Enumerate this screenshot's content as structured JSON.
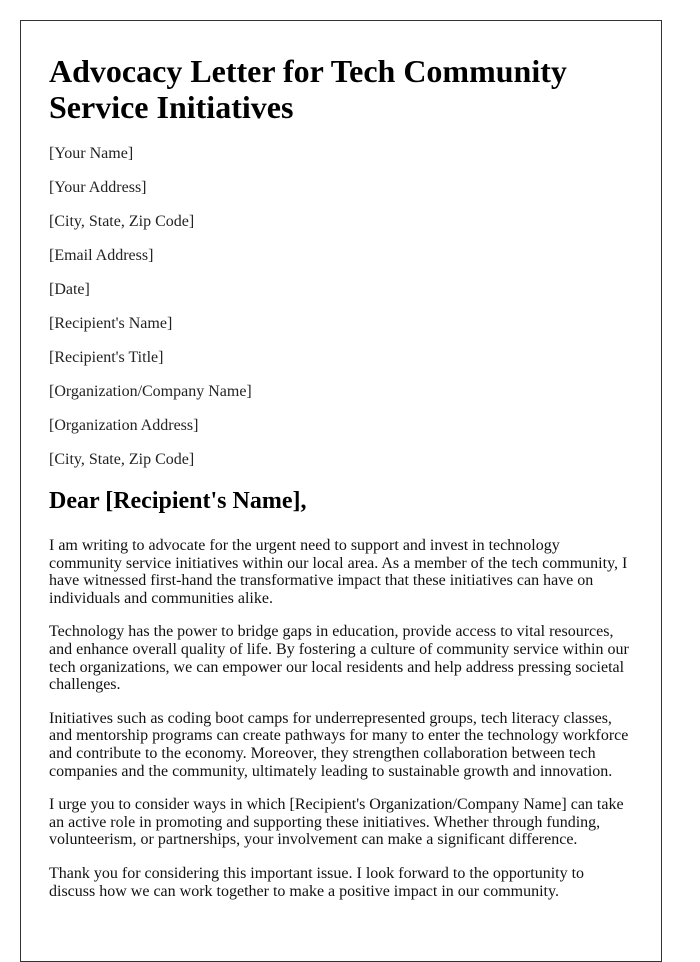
{
  "document": {
    "title": "Advocacy Letter for Tech Community Service Initiatives",
    "sender": {
      "name": "[Your Name]",
      "address": "[Your Address]",
      "city_state_zip": "[City, State, Zip Code]",
      "email": "[Email Address]",
      "date": "[Date]"
    },
    "recipient": {
      "name": "[Recipient's Name]",
      "title": "[Recipient's Title]",
      "organization": "[Organization/Company Name]",
      "organization_address": "[Organization Address]",
      "city_state_zip": "[City, State, Zip Code]"
    },
    "greeting": "Dear [Recipient's Name],",
    "paragraphs": [
      "I am writing to advocate for the urgent need to support and invest in technology community service initiatives within our local area. As a member of the tech community, I have witnessed first-hand the transformative impact that these initiatives can have on individuals and communities alike.",
      "Technology has the power to bridge gaps in education, provide access to vital resources, and enhance overall quality of life. By fostering a culture of community service within our tech organizations, we can empower our local residents and help address pressing societal challenges.",
      "Initiatives such as coding boot camps for underrepresented groups, tech literacy classes, and mentorship programs can create pathways for many to enter the technology workforce and contribute to the economy. Moreover, they strengthen collaboration between tech companies and the community, ultimately leading to sustainable growth and innovation.",
      "I urge you to consider ways in which [Recipient's Organization/Company Name] can take an active role in promoting and supporting these initiatives. Whether through funding, volunteerism, or partnerships, your involvement can make a significant difference.",
      "Thank you for considering this important issue. I look forward to the opportunity to discuss how we can work together to make a positive impact in our community."
    ]
  }
}
